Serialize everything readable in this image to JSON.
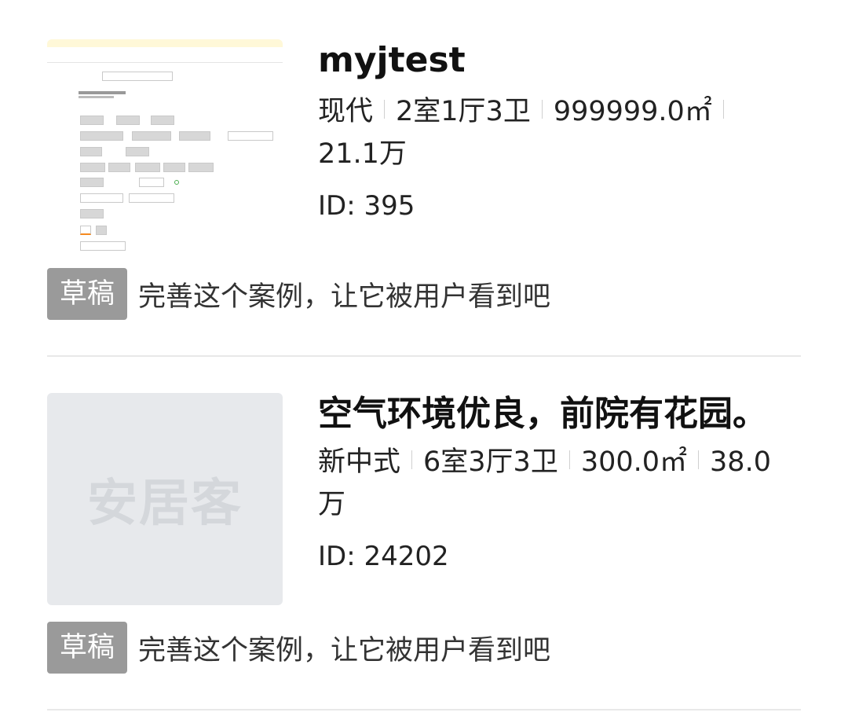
{
  "cases": [
    {
      "title": "myjtest",
      "style": "现代",
      "layout": "2室1厅3卫",
      "area": "999999.0㎡",
      "price": "21.1万",
      "id_text": "ID: 395",
      "status": "草稿",
      "hint": "完善这个案例，让它被用户看到吧",
      "thumbnail": "form-screenshot"
    },
    {
      "title": "空气环境优良，前院有花园。",
      "style": "新中式",
      "layout": "6室3厅3卫",
      "area": "300.0㎡",
      "price": "38.0万",
      "id_text": "ID: 24202",
      "status": "草稿",
      "hint": "完善这个案例，让它被用户看到吧",
      "thumbnail": "placeholder-logo",
      "placeholder_logo": "安居客"
    }
  ],
  "colors": {
    "badge_bg": "#9a9a9a",
    "placeholder_bg": "#e7e9ec",
    "divider": "#e8e8e8"
  }
}
